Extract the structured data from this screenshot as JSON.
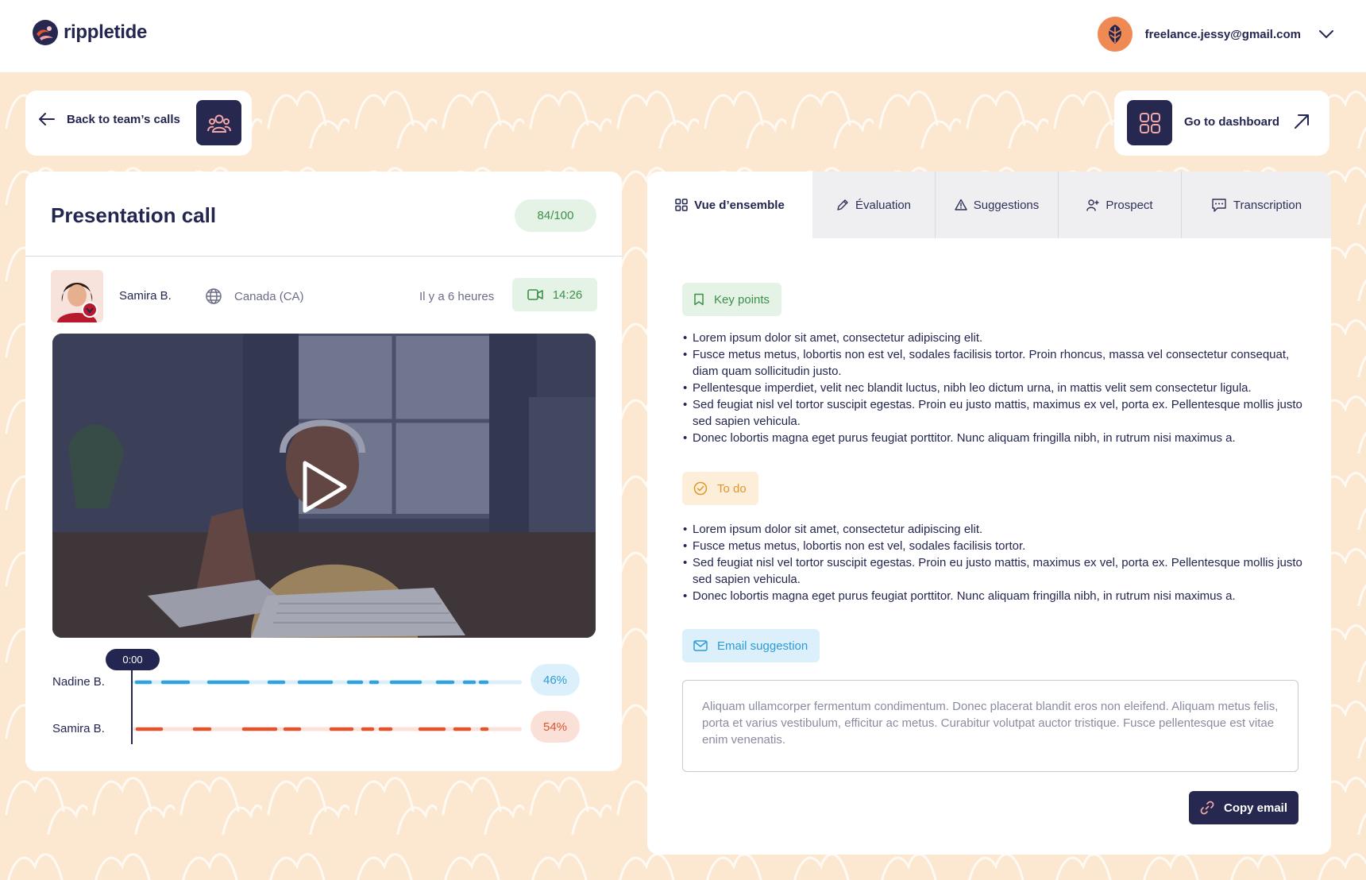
{
  "brand": {
    "name": "rippletide"
  },
  "user": {
    "email": "freelance.jessy@gmail.com"
  },
  "nav": {
    "back_label": "Back to team’s calls",
    "dashboard_label": "Go to dashboard"
  },
  "call": {
    "title": "Presentation call",
    "score": "84/100",
    "contact_name": "Samira B.",
    "country": "Canada (CA)",
    "time_ago": "Il y a 6 heures",
    "duration": "14:26"
  },
  "playback": {
    "position": "0:00",
    "speakers": [
      {
        "name": "Nadine B.",
        "share": "46%",
        "color": "#2ea3e0",
        "track_color": "#dceef7",
        "badge_bg": "#dcf0fb",
        "badge_fg": "#2e9ad6"
      },
      {
        "name": "Samira B.",
        "share": "54%",
        "color": "#e0552e",
        "track_color": "#fbe1d9",
        "badge_bg": "#fbe0d8",
        "badge_fg": "#d9552f"
      }
    ]
  },
  "tabs": [
    {
      "label": "Vue d’ensemble",
      "icon": "grid-icon",
      "active": true
    },
    {
      "label": "Évaluation",
      "icon": "pencil-icon",
      "active": false
    },
    {
      "label": "Suggestions",
      "icon": "warning-icon",
      "active": false
    },
    {
      "label": "Prospect",
      "icon": "user-add-icon",
      "active": false
    },
    {
      "label": "Transcription",
      "icon": "chat-icon",
      "active": false
    }
  ],
  "key_points": {
    "label": "Key points",
    "items": [
      "Lorem ipsum dolor sit amet, consectetur adipiscing elit.",
      "Fusce metus metus, lobortis non est vel, sodales facilisis tortor. Proin rhoncus, massa vel consectetur consequat, diam quam sollicitudin justo.",
      "Pellentesque imperdiet, velit nec blandit luctus, nibh leo dictum urna, in mattis velit sem consectetur ligula.",
      "Sed feugiat nisl vel tortor suscipit egestas. Proin eu justo mattis, maximus ex vel, porta ex. Pellentesque mollis justo sed sapien vehicula.",
      "Donec lobortis magna eget purus feugiat porttitor. Nunc aliquam fringilla nibh, in rutrum nisi maximus a."
    ]
  },
  "todo": {
    "label": "To do",
    "items": [
      "Lorem ipsum dolor sit amet, consectetur adipiscing elit.",
      "Fusce metus metus, lobortis non est vel, sodales facilisis tortor.",
      "Sed feugiat nisl vel tortor suscipit egestas. Proin eu justo mattis, maximus ex vel, porta ex. Pellentesque mollis justo sed sapien vehicula.",
      "Donec lobortis magna eget purus feugiat porttitor. Nunc aliquam fringilla nibh, in rutrum nisi maximus a."
    ]
  },
  "email": {
    "label": "Email suggestion",
    "body": "Aliquam ullamcorper fermentum condimentum. Donec placerat blandit eros non eleifend. Aliquam metus felis, porta et varius vestibulum, efficitur ac metus. Curabitur volutpat auctor tristique. Fusce pellentesque est vitae enim venenatis.",
    "copy_label": "Copy email"
  },
  "colors": {
    "navy": "#26284f",
    "background": "#fce8d0",
    "score_green": "#3c8f4a",
    "todo_orange": "#e0962a",
    "email_blue": "#2e9ad6"
  }
}
